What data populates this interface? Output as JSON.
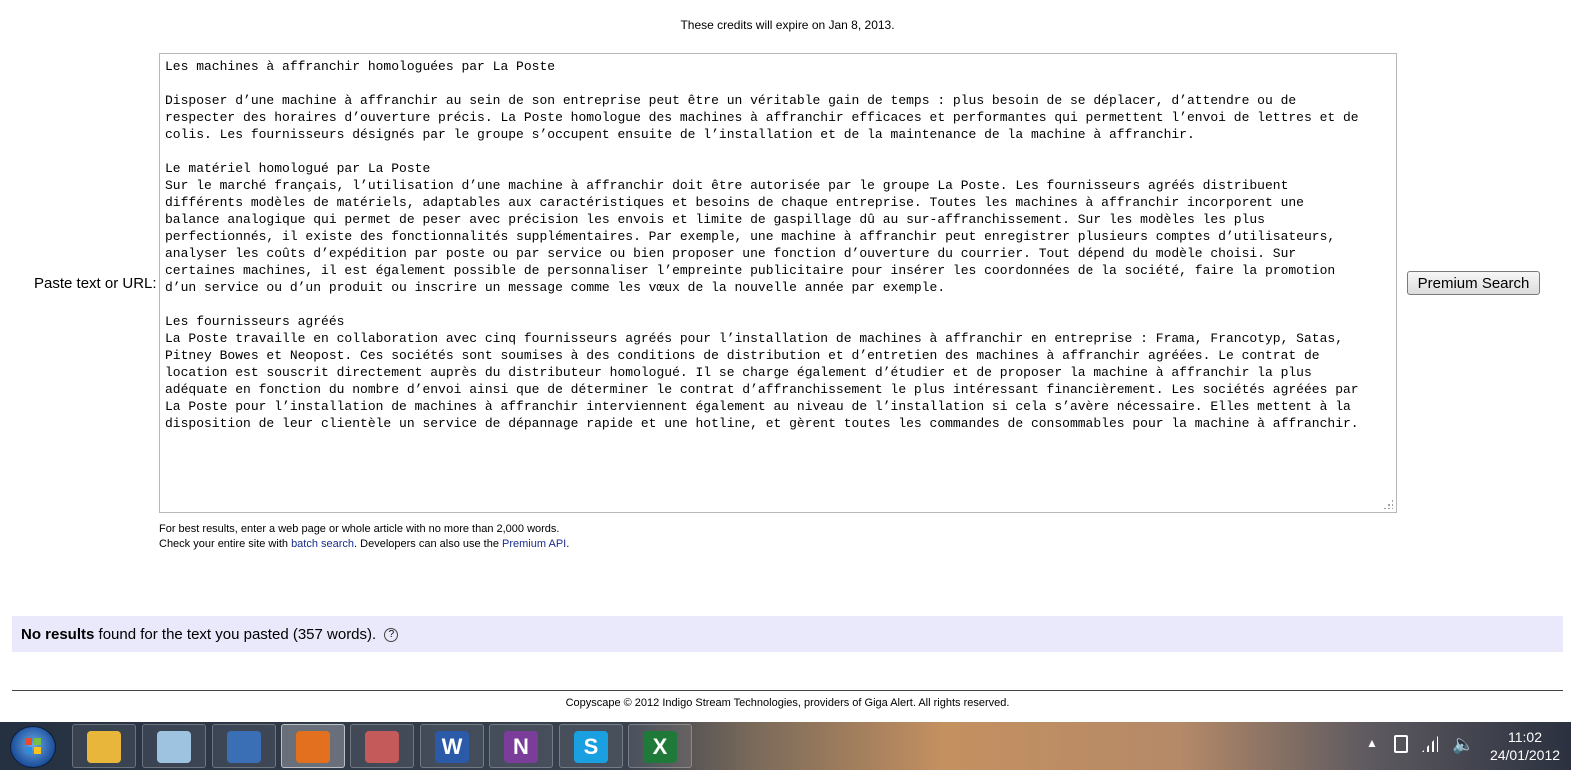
{
  "credits_note": "These credits will expire on Jan 8, 2013.",
  "paste_label": "Paste text or URL:",
  "textarea_lines": [
    "Les machines à affranchir homologuées par La Poste",
    "",
    "Disposer d’une machine à affranchir au sein de son entreprise peut être un véritable gain de temps : plus besoin de se déplacer, d’attendre ou de",
    "respecter des horaires d’ouverture précis. La Poste homologue des machines à affranchir efficaces et performantes qui permettent l’envoi de lettres et de",
    "colis. Les fournisseurs désignés par le groupe s’occupent ensuite de l’installation et de la maintenance de la machine à affranchir.",
    "",
    "Le matériel homologué par La Poste",
    "Sur le marché français, l’utilisation d’une machine à affranchir doit être autorisée par le groupe La Poste. Les fournisseurs agréés distribuent",
    "différents modèles de matériels, adaptables aux caractéristiques et besoins de chaque entreprise. Toutes les machines à affranchir incorporent une",
    "balance analogique qui permet de peser avec précision les envois et limite de gaspillage dû au sur-affranchissement. Sur les modèles les plus",
    "perfectionnés, il existe des fonctionnalités supplémentaires. Par exemple, une machine à affranchir peut enregistrer plusieurs comptes d’utilisateurs,",
    "analyser les coûts d’expédition par poste ou par service ou bien proposer une fonction d’ouverture du courrier. Tout dépend du modèle choisi. Sur",
    "certaines machines, il est également possible de personnaliser l’empreinte publicitaire pour insérer les coordonnées de la société, faire la promotion",
    "d’un service ou d’un produit ou inscrire un message comme les vœux de la nouvelle année par exemple.",
    "",
    "Les fournisseurs agréés",
    "La Poste travaille en collaboration avec cinq fournisseurs agréés pour l’installation de machines à affranchir en entreprise : Frama, Francotyp, Satas,",
    "Pitney Bowes et Neopost. Ces sociétés sont soumises à des conditions de distribution et d’entretien des machines à affranchir agréées. Le contrat de",
    "location est souscrit directement auprès du distributeur homologué. Il se charge également d’étudier et de proposer la machine à affranchir la plus",
    "adéquate en fonction du nombre d’envoi ainsi que de déterminer le contrat d’affranchissement le plus intéressant financièrement. Les sociétés agréées par",
    "La Poste pour l’installation de machines à affranchir interviennent également au niveau de l’installation si cela s’avère nécessaire. Elles mettent à la",
    "disposition de leur clientèle un service de dépannage rapide et une hotline, et gèrent toutes les commandes de consommables pour la machine à affranchir."
  ],
  "search_button": "Premium Search",
  "hint": {
    "line1": "For best results, enter a web page or whole article with no more than 2,000 words.",
    "line2_prefix": "Check your entire site with ",
    "batch_link": "batch search",
    "line2_middle": ". Developers can also use the ",
    "api_link": "Premium API",
    "line2_suffix": "."
  },
  "results": {
    "bold": "No results",
    "text": " found for the text you pasted (357 words).",
    "help_icon": "?"
  },
  "footer": "Copyscape © 2012 Indigo Stream Technologies, providers of Giga Alert. All rights reserved.",
  "taskbar": {
    "apps": [
      {
        "name": "Windows Explorer",
        "icon": "folder-icon",
        "color": "#e8b63a",
        "glyph": ""
      },
      {
        "name": "Notepad",
        "icon": "notepad-icon",
        "color": "#9ec3e0",
        "glyph": ""
      },
      {
        "name": "Thunderbird",
        "icon": "thunderbird-icon",
        "color": "#3a6fb5",
        "glyph": ""
      },
      {
        "name": "Firefox",
        "icon": "firefox-icon",
        "color": "#e2701f",
        "glyph": ""
      },
      {
        "name": "Snipping Tool",
        "icon": "scissors-icon",
        "color": "#c45a5a",
        "glyph": ""
      },
      {
        "name": "Word",
        "icon": "word-icon",
        "color": "#2a5aa8",
        "glyph": "W"
      },
      {
        "name": "OneNote",
        "icon": "onenote-icon",
        "color": "#7a3e9a",
        "glyph": "N"
      },
      {
        "name": "Skype",
        "icon": "skype-icon",
        "color": "#1aa0e0",
        "glyph": "S"
      },
      {
        "name": "Excel",
        "icon": "excel-icon",
        "color": "#1f7a3a",
        "glyph": "X"
      }
    ],
    "clock_time": "11:02",
    "clock_date": "24/01/2012"
  }
}
